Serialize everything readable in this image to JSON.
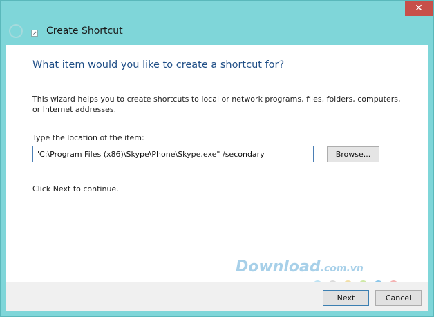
{
  "window": {
    "title": "Create Shortcut",
    "close_glyph": "✕"
  },
  "page": {
    "heading": "What item would you like to create a shortcut for?",
    "description": "This wizard helps you to create shortcuts to local or network programs, files, folders, computers, or Internet addresses.",
    "location_label": "Type the location of the item:",
    "location_value": "\"C:\\Program Files (x86)\\Skype\\Phone\\Skype.exe\" /secondary",
    "browse_label": "Browse...",
    "continue_text": "Click Next to continue."
  },
  "footer": {
    "next_label": "Next",
    "cancel_label": "Cancel"
  },
  "watermark": {
    "main": "Download",
    "suffix": ".com.vn",
    "dot_colors": [
      "#bfe3f3",
      "#dcdcdc",
      "#f2dfa8",
      "#cfe9a6",
      "#8cc7ea",
      "#f4b3b3"
    ]
  },
  "icons": {
    "back": "back-arrow-icon",
    "shortcut": "shortcut-icon",
    "close": "close-icon"
  }
}
